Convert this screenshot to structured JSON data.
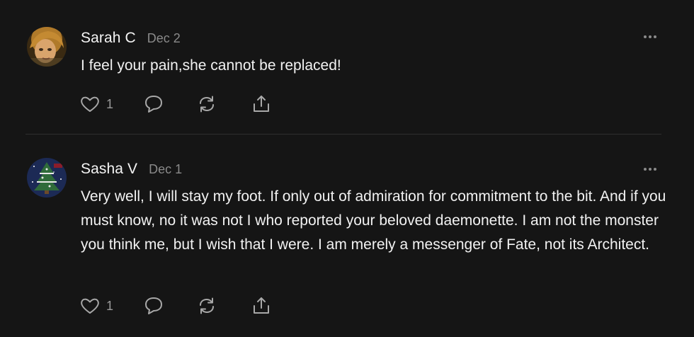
{
  "comments": [
    {
      "author": "Sarah C",
      "date": "Dec 2",
      "text": "I feel your pain,she cannot be replaced!",
      "likes": "1",
      "avatar_icon": "user-photo"
    },
    {
      "author": "Sasha V",
      "date": "Dec 1",
      "text": "Very well, I will stay my foot. If only out of admiration for commitment to the bit. And if you must know, no it was not I who reported your beloved daemonette. I am not the monster you think me, but I wish that I were. I am merely a messenger of Fate, not its Architect.",
      "likes": "1",
      "avatar_icon": "christmas-tree-avatar"
    }
  ],
  "icons": {
    "like": "heart-icon",
    "reply": "speech-bubble-icon",
    "restack": "restack-arrows-icon",
    "share": "share-icon",
    "more": "more-dots-icon"
  },
  "colors": {
    "background": "#151515",
    "text": "#f2f2f2",
    "muted": "#8a8a8a",
    "divider": "#2e2e2e"
  }
}
